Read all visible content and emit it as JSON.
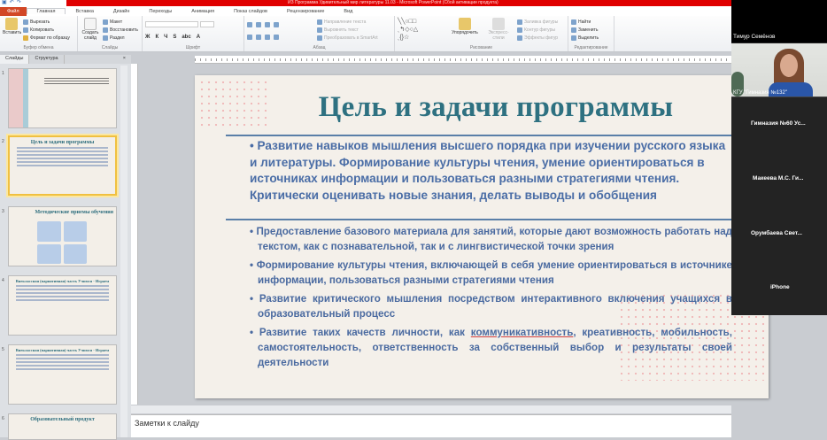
{
  "window": {
    "title": "ИЗ Программа Удивительный мир литературы 11.03 - Microsoft PowerPoint (Сбой активации продукта)"
  },
  "ribbon_tabs": [
    "Файл",
    "Главная",
    "Вставка",
    "Дизайн",
    "Переходы",
    "Анимация",
    "Показ слайдов",
    "Рецензирование",
    "Вид"
  ],
  "ribbon": {
    "clipboard": {
      "paste": "Вставить",
      "cut": "Вырезать",
      "copy": "Копировать",
      "format_painter": "Формат по образцу",
      "label": "Буфер обмена"
    },
    "slides": {
      "new_slide": "Создать слайд",
      "layout": "Макет",
      "reset": "Восстановить",
      "section": "Раздел",
      "label": "Слайды"
    },
    "font": {
      "label": "Шрифт"
    },
    "paragraph": {
      "text_direction": "Направление текста",
      "align_text": "Выровнять текст",
      "smartart": "Преобразовать в SmartArt",
      "label": "Абзац"
    },
    "drawing": {
      "arrange": "Упорядочить",
      "quick_styles": "Экспресс-стили",
      "fill": "Заливка фигуры",
      "outline": "Контур фигуры",
      "effects": "Эффекты фигур",
      "label": "Рисование"
    },
    "editing": {
      "find": "Найти",
      "replace": "Заменить",
      "select": "Выделить",
      "label": "Редактирование"
    }
  },
  "left_panel": {
    "tabs": [
      "Слайды",
      "Структура"
    ],
    "thumbnails": [
      {
        "num": "1",
        "title": ""
      },
      {
        "num": "2",
        "title": "Цель и задачи программы"
      },
      {
        "num": "3",
        "title": "Методические приемы обучения"
      },
      {
        "num": "4",
        "title": "Внеклассная (вариативная) часть Учимся - Играем"
      },
      {
        "num": "5",
        "title": "Внеклассная (вариативная) часть Учимся - Играем"
      },
      {
        "num": "6",
        "title": "Образовательный продукт"
      }
    ]
  },
  "slide": {
    "title": "Цель и задачи программы",
    "main_bullet": "Развитие навыков мышления высшего порядка при изучении русского языка и литературы. Формирование культуры чтения, умение ориентироваться в источниках информации и пользоваться разными стратегиями чтения. Критически оценивать новые знания, делать выводы и обобщения",
    "bullets": [
      "Предоставление базового материала для занятий, которые дают возможность работать над текстом, как с познавательной, так и с лингвистической точки зрения",
      "Формирование культуры чтения, включающей в себя умение ориентироваться в источнике информации, пользоваться разными стратегиями чтения",
      "Развитие критического мышления посредством интерактивного включения учащихся в образовательный процесс"
    ],
    "last_bullet": {
      "before": "Развитие таких качеств личности, как ",
      "underlined": "коммуникативность",
      "after": ", креативность, мобильность, самостоятельность, ответственность за собственный выбор и результаты своей деятельности"
    }
  },
  "notes_placeholder": "Заметки к слайду",
  "video": {
    "participants": [
      "Тимур Семёнов",
      "КГУ \"Гимназия №132\"",
      "Гимназия №60 Ус...",
      "Макеева М.С. Ги...",
      "Орумбаева Свет...",
      "iPhone"
    ]
  },
  "colors": {
    "title_bar": "#e00000",
    "slide_title": "#2e7181",
    "slide_text": "#4a6da6",
    "file_tab": "#d24726"
  }
}
